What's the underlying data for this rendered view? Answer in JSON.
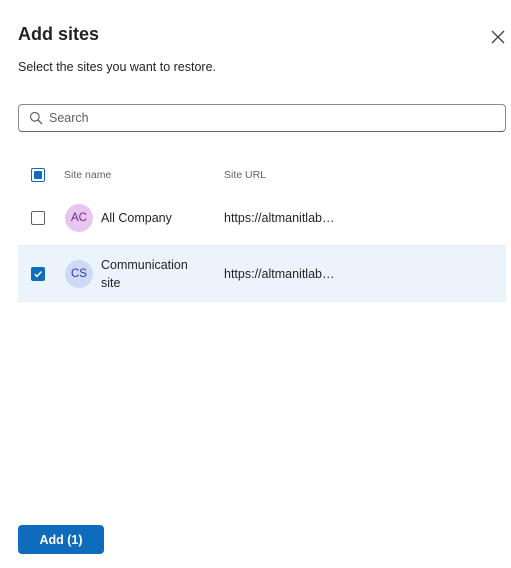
{
  "dialog": {
    "title": "Add sites",
    "subtitle": "Select the sites you want to restore.",
    "close_icon": "close-icon"
  },
  "search": {
    "placeholder": "Search",
    "value": "",
    "icon": "search-icon"
  },
  "table": {
    "columns": [
      "Site name",
      "Site URL"
    ],
    "select_all_state": "mixed",
    "rows": [
      {
        "initials": "AC",
        "name": "All Company",
        "url": "https://altmanitlab…",
        "checked": false,
        "avatar_bg": "#e8c6ef",
        "avatar_fg": "#6b2e7e"
      },
      {
        "initials": "CS",
        "name": "Communication site",
        "url": "https://altmanitlab…",
        "checked": true,
        "avatar_bg": "#cfd9f7",
        "avatar_fg": "#2c3e8c"
      }
    ]
  },
  "footer": {
    "add_label": "Add (1)"
  },
  "colors": {
    "accent": "#0f6cbd",
    "selected_row": "#ebf3fc"
  }
}
